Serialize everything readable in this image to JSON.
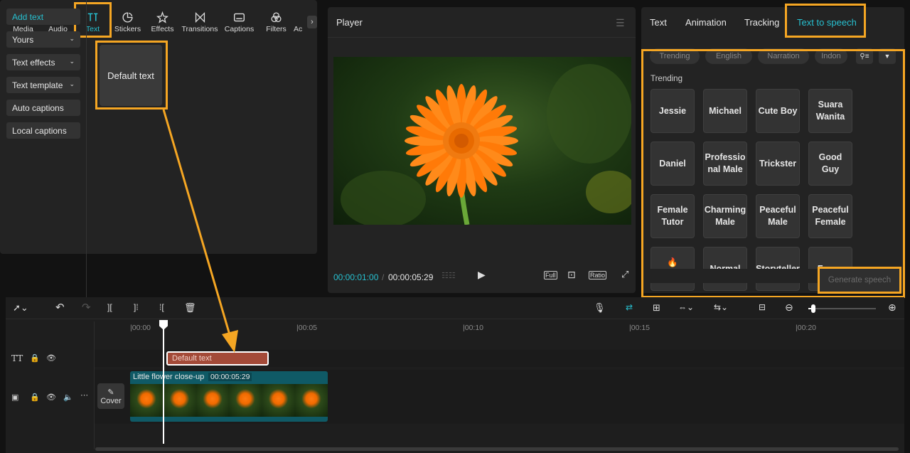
{
  "tools": [
    {
      "label": "Media",
      "icon": "media-icon"
    },
    {
      "label": "Audio",
      "icon": "audio-icon"
    },
    {
      "label": "Text",
      "icon": "text-icon"
    },
    {
      "label": "Stickers",
      "icon": "sticker-icon"
    },
    {
      "label": "Effects",
      "icon": "effects-icon"
    },
    {
      "label": "Transitions",
      "icon": "transitions-icon"
    },
    {
      "label": "Captions",
      "icon": "captions-icon"
    },
    {
      "label": "Filters",
      "icon": "filters-icon"
    },
    {
      "label": "Ac",
      "icon": "adjust-icon"
    }
  ],
  "left_nav": {
    "add_text": "Add text",
    "yours": "Yours",
    "text_effects": "Text effects",
    "text_template": "Text template",
    "auto_captions": "Auto captions",
    "local_captions": "Local captions"
  },
  "default_text_card": "Default text",
  "player": {
    "title": "Player",
    "current_time": "00:00:01:00",
    "separator": "/",
    "total_time": "00:00:05:29",
    "full_label": "Full",
    "ratio_label": "Ratio"
  },
  "right_tabs": {
    "text": "Text",
    "animation": "Animation",
    "tracking": "Tracking",
    "tts": "Text to speech"
  },
  "filter_chips": [
    "Trending",
    "English",
    "Narration",
    "Indon"
  ],
  "trending_label": "Trending",
  "voices": [
    [
      "Jessie",
      "Michael",
      "Cute Boy",
      "Suara Wanita"
    ],
    [
      "Daniel",
      "Professio nal Male",
      "Trickster",
      "Good Guy"
    ],
    [
      "Female Tutor",
      "Charming Male",
      "Peaceful Male",
      "Peaceful Female"
    ],
    [
      "🔥Excited",
      "Normal",
      "Storyteller",
      "Fussy"
    ]
  ],
  "generate_speech": "Generate speech",
  "ruler_ticks": [
    "00:00",
    "00:05",
    "00:10",
    "00:15",
    "00:20"
  ],
  "text_clip_label": "Default text",
  "video_clip": {
    "name": "Little flower close-up",
    "duration": "00:00:05:29"
  },
  "cover_label": "Cover",
  "colors": {
    "accent": "#27c0d0",
    "highlight": "#f5a623",
    "text_clip": "#a34a38",
    "video_clip": "#0f5a66"
  }
}
